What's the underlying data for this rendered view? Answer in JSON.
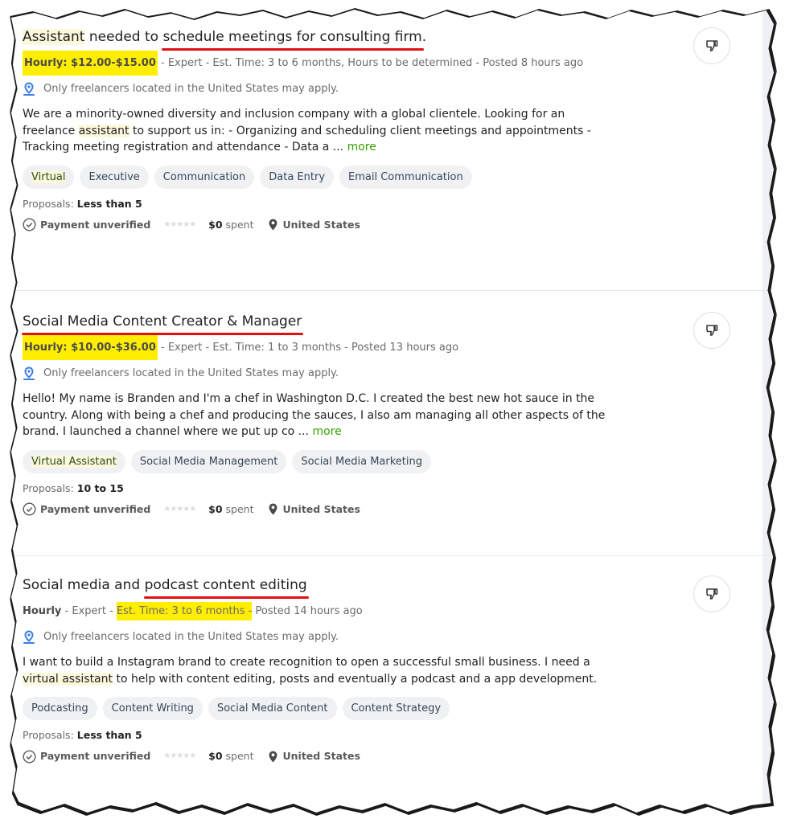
{
  "colors": {
    "highlight_yellow": "#ffee00",
    "keyword_highlight": "#fbf8dc",
    "red_underline": "#e01010",
    "more_link": "#37a000",
    "location_pin_blue": "#3d7de4"
  },
  "jobs": [
    {
      "title_parts": {
        "keyword": "Assistant",
        "middle": " needed to ",
        "underlined": "schedule meetings for consulting firm",
        "end": "."
      },
      "rate": "Hourly: $12.00-$15.00",
      "meta_rest": " - Expert - Est. Time: 3 to 6 months, Hours to be determined - Posted 8 hours ago",
      "location_note": "Only freelancers located in the United States may apply.",
      "description": {
        "before": "We are a minority-owned diversity and inclusion company with a global clientele. Looking for an freelance ",
        "keyword": "assistant",
        "after": " to support us in: - Organizing and scheduling client meetings and appointments - Tracking meeting registration and attendance - Data a ... ",
        "more": "more"
      },
      "skills": [
        "Virtual",
        "Executive",
        "Communication",
        "Data Entry",
        "Email Communication"
      ],
      "proposals_label": "Proposals: ",
      "proposals_value": "Less than 5",
      "payment_status": "Payment unverified",
      "rating_stars": 0,
      "spent_amount": "$0",
      "spent_label": " spent",
      "country": "United States",
      "dislike_icon": "thumbs-down-icon"
    },
    {
      "title": "Social Media Content Creator & Manager",
      "rate": "Hourly: $10.00-$36.00",
      "meta_rest": " - Expert - Est. Time: 1 to 3 months - Posted 13 hours ago",
      "location_note": "Only freelancers located in the United States may apply.",
      "description": {
        "text": "Hello! My name is Branden and I'm a chef in Washington D.C. I created the best new hot sauce in the country. Along with being a chef and producing the sauces, I also am managing all other aspects of the brand. I launched a channel where we put up co ... ",
        "more": "more"
      },
      "skills": [
        "Virtual Assistant",
        "Social Media Management",
        "Social Media Marketing"
      ],
      "proposals_label": "Proposals: ",
      "proposals_value": "10 to 15",
      "payment_status": "Payment unverified",
      "rating_stars": 0,
      "spent_amount": "$0",
      "spent_label": " spent",
      "country": "United States",
      "dislike_icon": "thumbs-down-icon"
    },
    {
      "title_parts": {
        "start": "Social media and ",
        "underlined": "podcast content editing"
      },
      "rate": "Hourly",
      "meta_mid": " - Expert - ",
      "meta_highlight": "Est. Time: 3 to 6 months -",
      "meta_end": " Posted 14 hours ago",
      "location_note": "Only freelancers located in the United States may apply.",
      "description": {
        "before": "I want to build a Instagram brand to create recognition to open a successful small business. I need a ",
        "keyword": "virtual assistant",
        "after": " to help with content editing, posts and eventually a podcast and a app development."
      },
      "skills": [
        "Podcasting",
        "Content Writing",
        "Social Media Content",
        "Content Strategy"
      ],
      "proposals_label": "Proposals: ",
      "proposals_value": "Less than 5",
      "payment_status": "Payment unverified",
      "rating_stars": 0,
      "spent_amount": "$0",
      "spent_label": " spent",
      "country": "United States",
      "dislike_icon": "thumbs-down-icon"
    }
  ],
  "stars_glyph": "★★★★★"
}
